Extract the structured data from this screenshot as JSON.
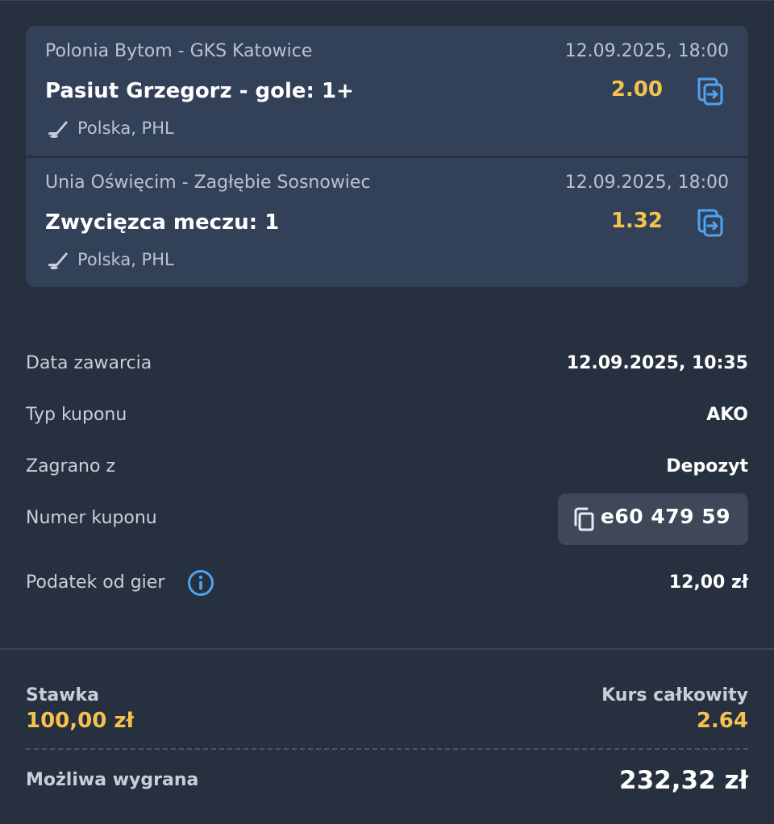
{
  "bets": [
    {
      "match": "Polonia Bytom - GKS Katowice",
      "datetime": "12.09.2025, 18:00",
      "selection": "Pasiut Grzegorz - gole: 1+",
      "odds": "2.00",
      "league": "Polska, PHL",
      "sport_icon": "hockey-stick-icon",
      "action_icon": "swap-icon"
    },
    {
      "match": "Unia Oświęcim - Zagłębie Sosnowiec",
      "datetime": "12.09.2025, 18:00",
      "selection": "Zwycięzca meczu: 1",
      "odds": "1.32",
      "league": "Polska, PHL",
      "sport_icon": "hockey-stick-icon",
      "action_icon": "swap-icon"
    }
  ],
  "details": {
    "date_label": "Data zawarcia",
    "date_value": "12.09.2025, 10:35",
    "type_label": "Typ kuponu",
    "type_value": "AKO",
    "played_from_label": "Zagrano z",
    "played_from_value": "Depozyt",
    "coupon_label": "Numer kuponu",
    "coupon_value": "e60 479 59",
    "tax_label": "Podatek od gier",
    "tax_value": "12,00 zł"
  },
  "summary": {
    "stake_label": "Stawka",
    "stake_value": "100,00 zł",
    "total_odds_label": "Kurs całkowity",
    "total_odds_value": "2.64",
    "win_label": "Możliwa wygrana",
    "win_value": "232,32 zł"
  },
  "colors": {
    "background": "#27303f",
    "card": "#334158",
    "accent_odds": "#f5c24f",
    "icon_blue": "#4ea3f2"
  }
}
